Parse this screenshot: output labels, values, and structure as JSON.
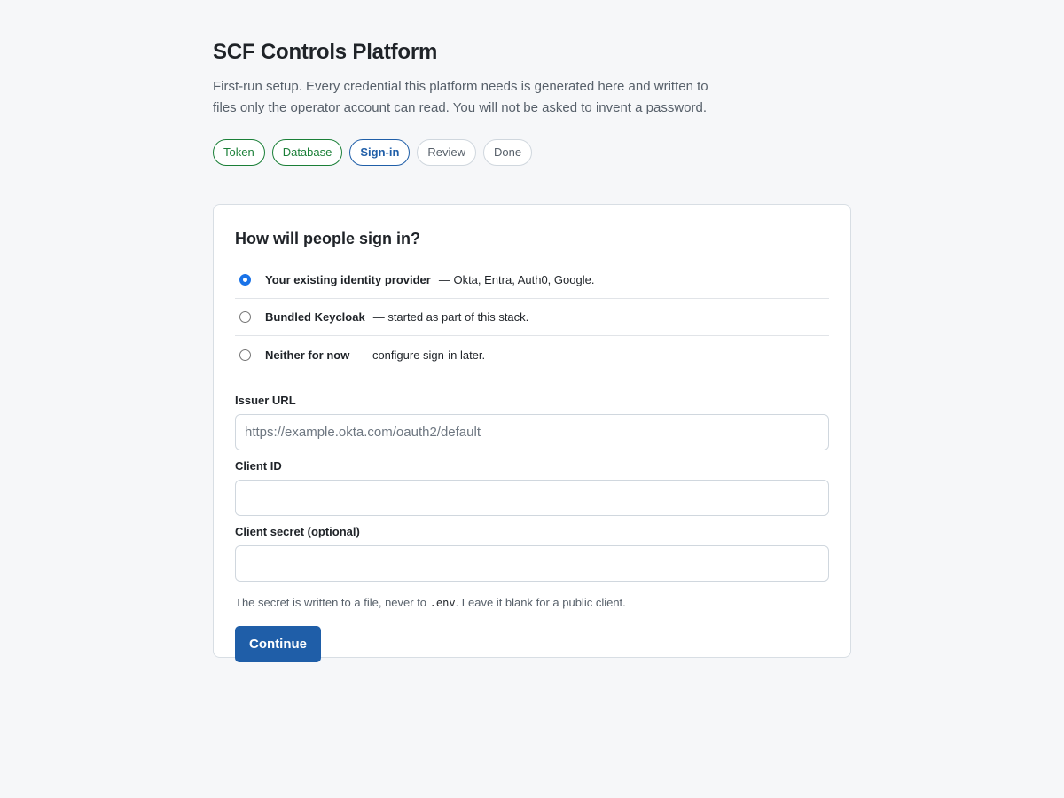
{
  "page": {
    "title": "SCF Controls Platform",
    "intro": "First-run setup. Every credential this platform needs is generated here and written to files only the operator account can read. You will not be asked to invent a password."
  },
  "steps": [
    {
      "label": "Token",
      "state": "done"
    },
    {
      "label": "Database",
      "state": "done"
    },
    {
      "label": "Sign-in",
      "state": "active"
    },
    {
      "label": "Review",
      "state": "pending"
    },
    {
      "label": "Done",
      "state": "pending"
    }
  ],
  "signin": {
    "heading": "How will people sign in?",
    "options": [
      {
        "name": "Your existing identity provider",
        "desc": "— Okta, Entra, Auth0, Google.",
        "checked": true
      },
      {
        "name": "Bundled Keycloak",
        "desc": "— started as part of this stack.",
        "checked": false
      },
      {
        "name": "Neither for now",
        "desc": "— configure sign-in later.",
        "checked": false
      }
    ],
    "fields": {
      "issuer_url": {
        "label": "Issuer URL",
        "value": "",
        "placeholder": "https://example.okta.com/oauth2/default"
      },
      "client_id": {
        "label": "Client ID",
        "value": "",
        "placeholder": ""
      },
      "client_secret": {
        "label": "Client secret (optional)",
        "value": "",
        "placeholder": ""
      }
    },
    "help_before": "The secret is written to a file, never to ",
    "help_code": ".env",
    "help_after": ". Leave it blank for a public client.",
    "continue_label": "Continue"
  },
  "colors": {
    "accent": "#1f5ea8",
    "done": "#1a7f37",
    "radio_checked": "#1a73e8",
    "background": "#f6f7f9"
  }
}
